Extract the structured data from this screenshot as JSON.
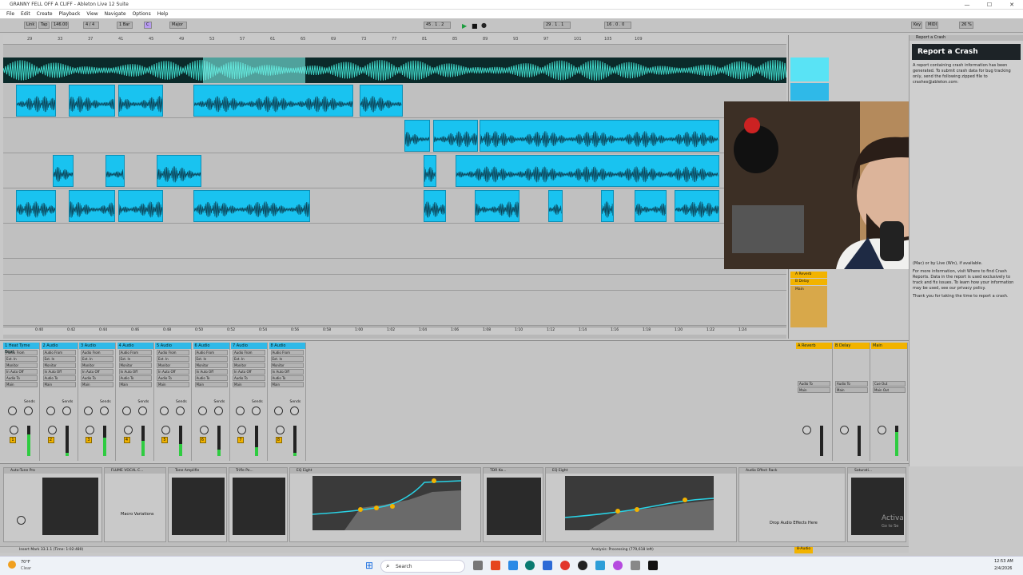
{
  "window": {
    "title": "GRANNY FELL OFF A CLIFF - Ableton Live 12 Suite",
    "min": "—",
    "max": "☐",
    "close": "✕"
  },
  "menu": [
    "File",
    "Edit",
    "Create",
    "Playback",
    "View",
    "Navigate",
    "Options",
    "Help"
  ],
  "transport": {
    "link": "Link",
    "tap": "Tap",
    "tempo": "146.00",
    "sig": "4 / 4",
    "bar": "1 Bar",
    "key": "C",
    "scale": "Major",
    "pos": "45 . 1 . 2",
    "loop": "29 . 1 . 1",
    "len": "16 . 0 . 0",
    "key_label": "Key",
    "midi": "MIDI",
    "cpu": "26 %"
  },
  "ruler": [
    "29",
    "33",
    "37",
    "41",
    "45",
    "49",
    "53",
    "57",
    "61",
    "65",
    "69",
    "73",
    "77",
    "81",
    "85",
    "89",
    "93",
    "97",
    "101",
    "105",
    "109"
  ],
  "time_ruler": [
    "0:40",
    "0:42",
    "0:44",
    "0:46",
    "0:48",
    "0:50",
    "0:52",
    "0:54",
    "0:56",
    "0:58",
    "1:00",
    "1:02",
    "1:04",
    "1:06",
    "1:08",
    "1:10",
    "1:12",
    "1:14",
    "1:16",
    "1:18",
    "1:20",
    "1:22",
    "1:24"
  ],
  "tracks": [
    "1 Heat Tyme Beat",
    "2 Audio",
    "3 Audio",
    "4 Audio",
    "5 Audio",
    "6 Audio",
    "7 Audio",
    "8 Audio"
  ],
  "returns": [
    "A Reverb",
    "B Delay",
    "Main"
  ],
  "mixer_labels": {
    "audio_from": "Audio From",
    "ext_in": "Ext. In",
    "monitor": "Monitor",
    "in": "In",
    "auto": "Auto",
    "off": "Off",
    "audio_to": "Audio To",
    "main": "Main",
    "sends": "Sends",
    "cue_out": "Cue Out",
    "main_out": "Main Out",
    "post": "Post"
  },
  "track_numbers": [
    "1",
    "2",
    "3",
    "4",
    "5",
    "6",
    "7",
    "8"
  ],
  "crash": {
    "header": "Report a Crash",
    "title": "Report a Crash",
    "p1": "A report containing crash information has been generated. To submit crash data for bug tracking only, send the following zipped file to crashes@ableton.com:",
    "p2": "(Mac) or by Live (Win), if available.",
    "p3": "For more information, visit Where to find Crash Reports. Data in the report is used exclusively to track and fix issues. To learn how your information may be used, see our privacy policy.",
    "p4": "Thank you for taking the time to report a crash."
  },
  "devices": [
    {
      "name": "Auto-Tune Pro"
    },
    {
      "name": "FLUME VOCAL C..."
    },
    {
      "name": "Tone Amplifie"
    },
    {
      "name": "Trifle Po..."
    },
    {
      "name": "EQ Eight"
    },
    {
      "name": "TDR Ko..."
    },
    {
      "name": "EQ Eight"
    },
    {
      "name": "Audio Effect Rack"
    },
    {
      "name": "Saturati..."
    }
  ],
  "device_text": {
    "macro": "Macro Variations",
    "drop": "Drop Audio Effects Here",
    "activate": "Activa",
    "activate2": "Go to Se"
  },
  "status": {
    "left": "Insert Mark 33.1.1 (Time: 1:02:480)",
    "mid": "Analysis: Processing (779,618 left)",
    "track": "8-Audio"
  },
  "taskbar": {
    "weather_temp": "70°F",
    "weather": "Clear",
    "search": "Search",
    "time": "12:53 AM",
    "date": "2/4/2026"
  },
  "colors": {
    "clip": "#19c3f0",
    "accent": "#f2b300",
    "track_header": "#2fb9e8"
  }
}
